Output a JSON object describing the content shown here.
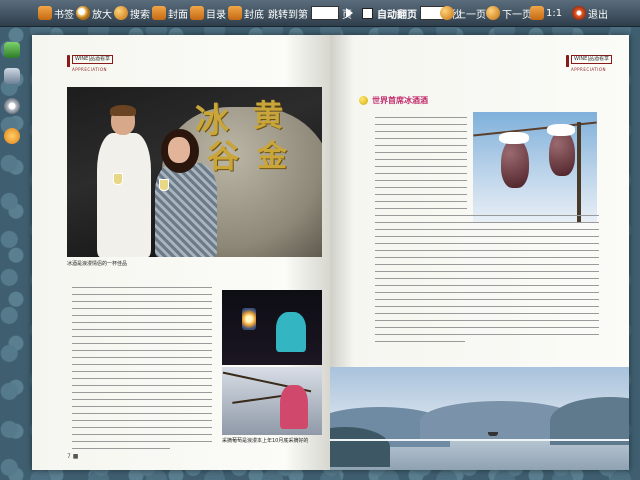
{
  "toolbar": {
    "bookmark": "书签",
    "zoom": "放大",
    "search": "搜索",
    "cover": "封面",
    "toc": "目录",
    "back_cover": "封底",
    "jump_to": "跳转到第",
    "page_unit": "页",
    "auto_flip": "自动翻页",
    "seconds": "秒",
    "prev_page": "上一页",
    "next_page": "下一页",
    "ratio": "1:1",
    "exit": "退出"
  },
  "left_page": {
    "logo_word": "WINE|",
    "logo_cn": "品酒看享",
    "logo_sub": "APPRECIATION",
    "photo_chars": [
      "冰",
      "谷",
      "黄",
      "金"
    ],
    "main_caption": "冰酒是浪漫情侣的一杯佳品",
    "bottom_caption": "采摘葡萄是浪漫本上年10月底采摘好的",
    "page_number": "7 ■"
  },
  "right_page": {
    "logo_word": "WINE|",
    "logo_cn": "品酒看享",
    "logo_sub": "APPRECIATION",
    "article_title": "世界首席冰酒酒"
  },
  "colors": {
    "toolbar_top": "#5a6d7d",
    "toolbar_bottom": "#2f3e4b",
    "accent_orange": "#e78a24",
    "title_pink": "#c22a6a",
    "logo_red": "#8a1a1a"
  }
}
